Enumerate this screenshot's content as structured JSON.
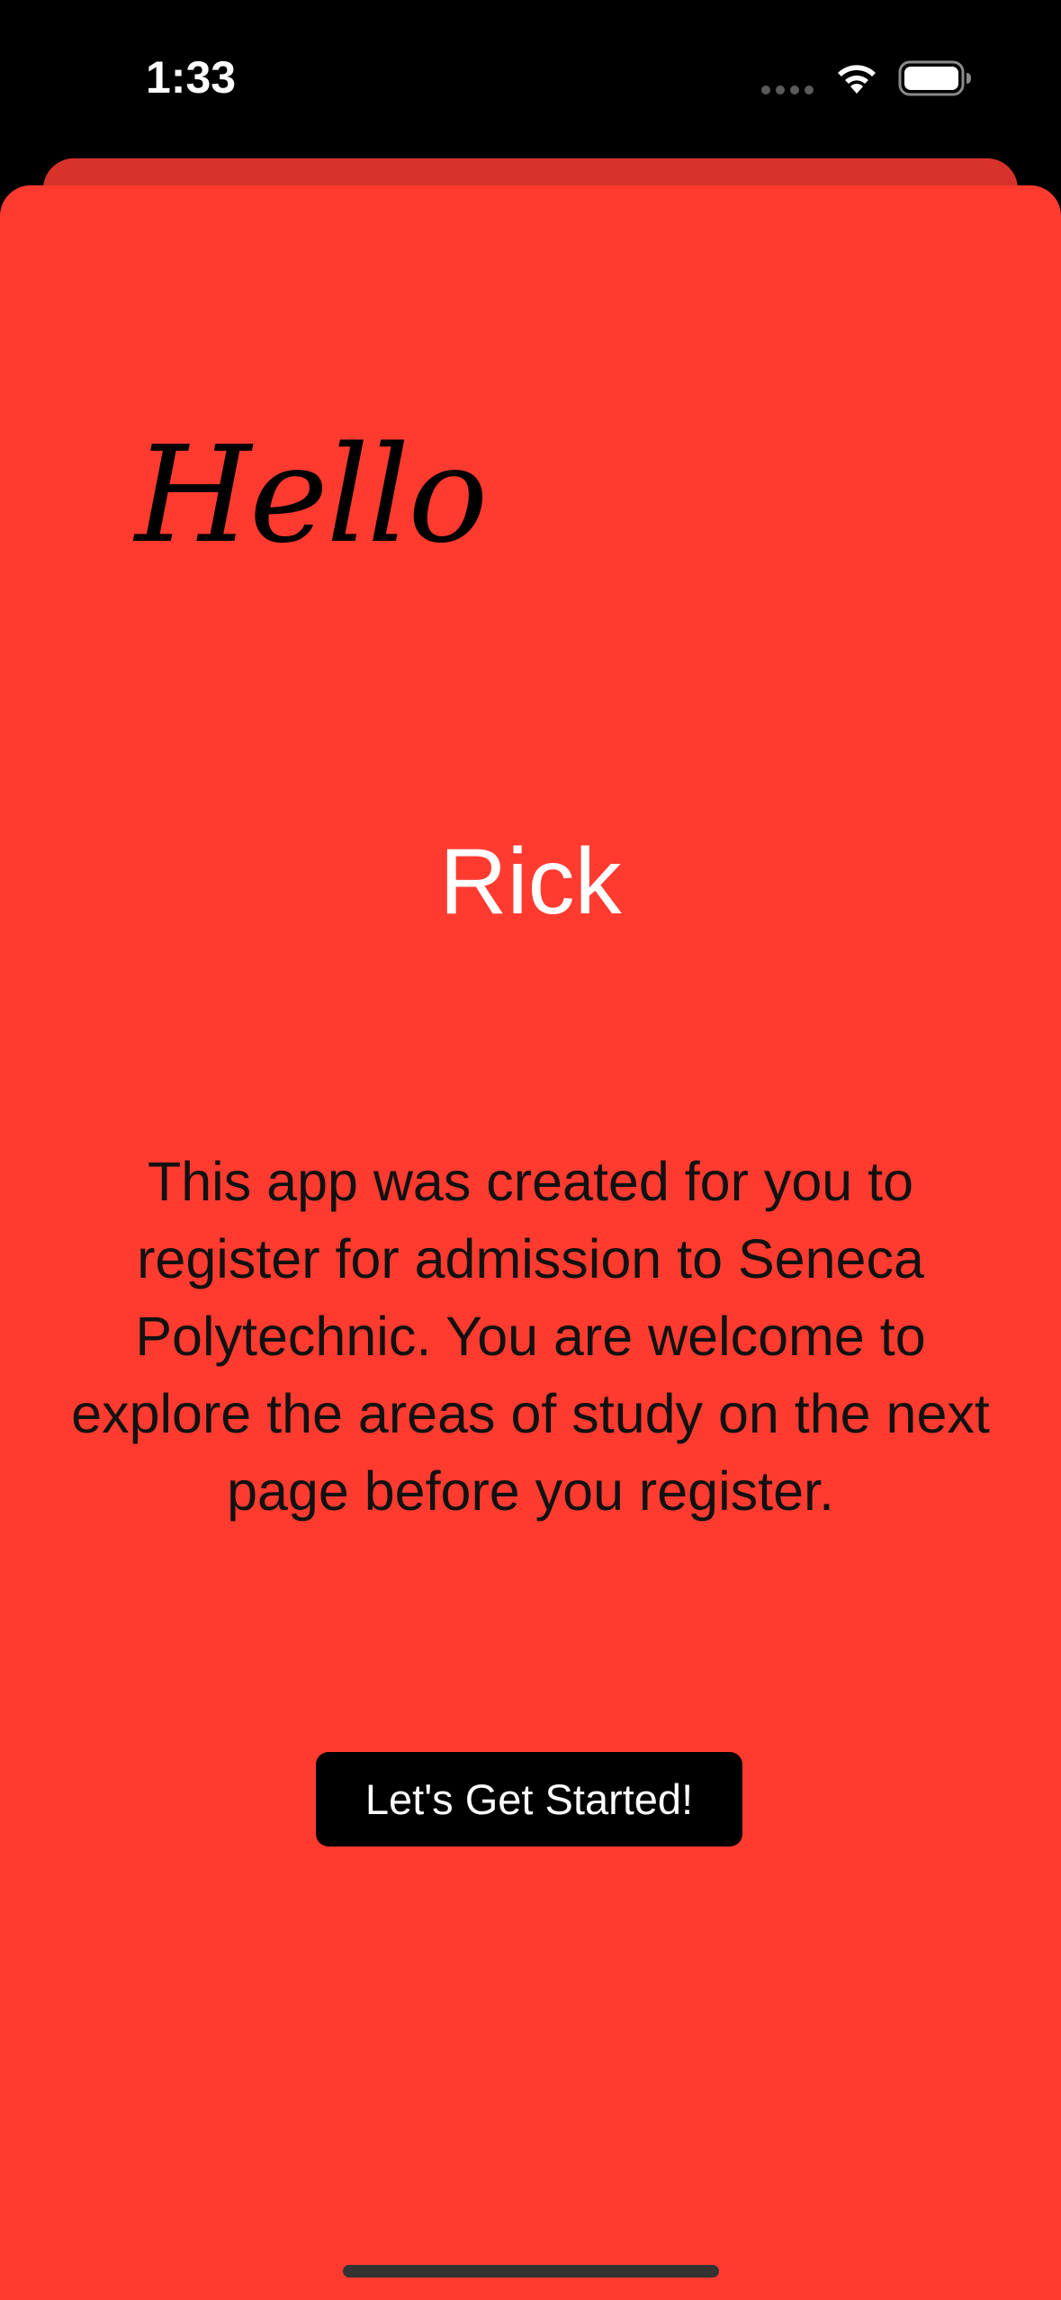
{
  "status_bar": {
    "time": "1:33",
    "icons": [
      "cellular-signal-icon",
      "wifi-icon",
      "battery-icon"
    ]
  },
  "main": {
    "greeting": "Hello",
    "user_name": "Rick",
    "description": "This app was created for you to register for admission to Seneca Polytechnic. You are welcome to explore the areas of study on the next page before you register.",
    "start_button_label": "Let's Get Started!"
  },
  "colors": {
    "background": "#000000",
    "sheet": "#ff3b30",
    "back_card": "#d8332b",
    "button": "#000000",
    "button_text": "#ffffff",
    "name_text": "#ffffff"
  }
}
